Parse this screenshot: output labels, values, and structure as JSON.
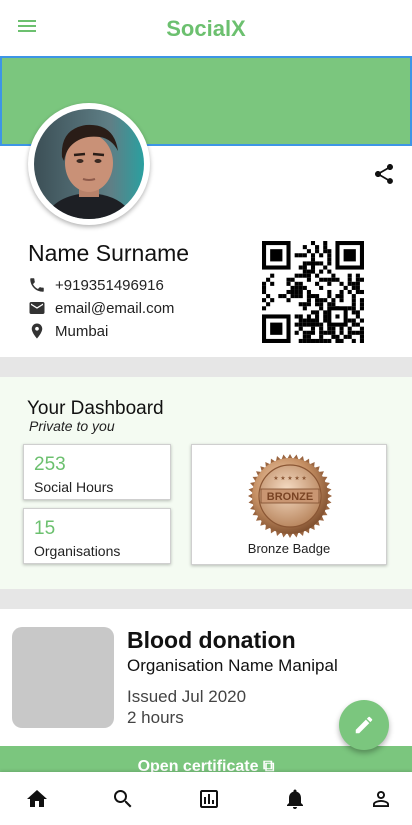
{
  "app": {
    "title": "SocialX"
  },
  "profile": {
    "name": "Name Surname",
    "phone": "+919351496916",
    "email": "email@email.com",
    "location": "Mumbai"
  },
  "dashboard": {
    "title": "Your Dashboard",
    "subtitle": "Private to you",
    "stats": [
      {
        "value": "253",
        "label": "Social Hours"
      },
      {
        "value": "15",
        "label": "Organisations"
      }
    ],
    "badge": {
      "medal_text": "BRONZE",
      "label": "Bronze Badge"
    }
  },
  "certificate": {
    "title": "Blood donation",
    "organisation": "Organisation Name Manipal",
    "issued": "Issued Jul 2020",
    "duration": "2 hours",
    "open_label": "Open certificate"
  },
  "bottom_nav": [
    "home-icon",
    "search-icon",
    "bar-chart-icon",
    "notifications-icon",
    "account-icon"
  ],
  "colors": {
    "accent": "#6cc06f",
    "cover": "#7bc67e",
    "divider": "#e6e6e6"
  }
}
